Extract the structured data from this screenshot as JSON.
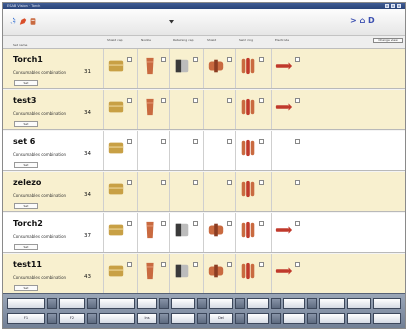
{
  "window": {
    "title": "ESAB Vision · Torch"
  },
  "toolbar": {
    "nav_label": "> ⌂ D"
  },
  "table": {
    "header_label": "Set name",
    "control_button": "Change view",
    "columns": [
      "Shield cap",
      "Nozzle",
      "Retaining cap",
      "Shield",
      "Swirl ring",
      "Electrode"
    ]
  },
  "sets": [
    {
      "name": "Torch1",
      "consumables_label": "Consumables combination",
      "count": "31",
      "button": "Set",
      "style": "alt"
    },
    {
      "name": "test3",
      "consumables_label": "Consumables combination",
      "count": "34",
      "button": "Set",
      "style": "alt"
    },
    {
      "name": "set 6",
      "consumables_label": "Consumables combination",
      "count": "34",
      "button": "Set",
      "style": "plain"
    },
    {
      "name": "zelezo",
      "consumables_label": "Consumables combination",
      "count": "34",
      "button": "Set",
      "style": "alt"
    },
    {
      "name": "Torch2",
      "consumables_label": "Consumables combination",
      "count": "37",
      "button": "Set",
      "style": "plain"
    },
    {
      "name": "test11",
      "consumables_label": "Consumables combination",
      "count": "43",
      "button": "Set",
      "style": "alt"
    }
  ],
  "bottom_bar": {
    "btn_a": "F1",
    "btn_b": "F2",
    "btn_c": "Ins",
    "btn_d": "Del"
  },
  "colors": {
    "accent": "#2a4478",
    "row_alt": "#f8f0cf",
    "brass": "#c8a045",
    "copper": "#c96a40",
    "electrode_red": "#c0392b",
    "nav_icon": "#3b4fb0"
  }
}
